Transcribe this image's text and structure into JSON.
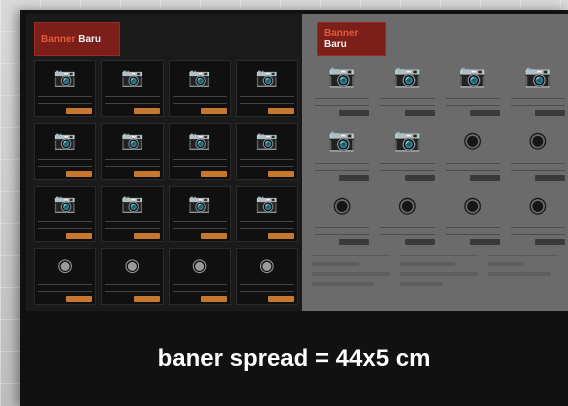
{
  "left_panel": {
    "badge": {
      "title": "Banner",
      "title_strong": "Baru"
    },
    "tile_icons": [
      "camera-icon",
      "camera-icon",
      "camera-icon",
      "camera-icon",
      "camera-icon",
      "camera-icon",
      "camera-icon",
      "camera-icon",
      "camera-icon",
      "camera-icon",
      "camera-icon",
      "camera-icon",
      "lens-icon",
      "lens-icon",
      "lens-icon",
      "lens-icon"
    ]
  },
  "right_panel": {
    "badge": {
      "title": "Banner",
      "title_strong": "Baru"
    },
    "tile_icons": [
      "camera-icon",
      "camera-icon",
      "camera-icon",
      "camera-icon",
      "camera-icon",
      "camera-icon",
      "lens-icon",
      "lens-icon",
      "lens-icon",
      "lens-icon",
      "lens-icon",
      "lens-icon"
    ]
  },
  "caption": "baner spread = 44x5 cm",
  "colors": {
    "left_panel_bg": "#1a1a1a",
    "right_panel_bg": "#6b6b6b",
    "badge_bg": "#7c1f1a",
    "price_button": "#c7772e"
  }
}
